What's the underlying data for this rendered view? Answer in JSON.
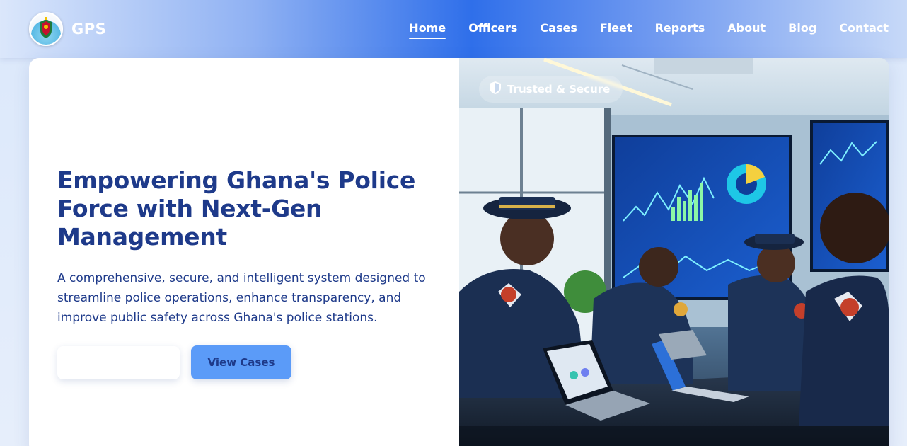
{
  "header": {
    "brand": "GPS",
    "logo_icon": "police-crest-icon",
    "nav": [
      {
        "label": "Home",
        "active": true
      },
      {
        "label": "Officers",
        "active": false
      },
      {
        "label": "Cases",
        "active": false
      },
      {
        "label": "Fleet",
        "active": false
      },
      {
        "label": "Reports",
        "active": false
      },
      {
        "label": "About",
        "active": false
      },
      {
        "label": "Blog",
        "active": false
      },
      {
        "label": "Contact",
        "active": false
      }
    ]
  },
  "hero": {
    "title": "Empowering Ghana's Police Force with Next-Gen Management",
    "description": "A comprehensive, secure, and intelligent system designed to streamline police operations, enhance transparency, and improve public safety across Ghana's police stations.",
    "primary_button_label": "",
    "secondary_button_label": "View Cases",
    "badge": {
      "icon": "shield-icon",
      "label": "Trusted & Secure"
    }
  },
  "colors": {
    "heading": "#1e3a8a",
    "accent_button": "#5b9bf8",
    "header_blue": "#2f6fea"
  }
}
